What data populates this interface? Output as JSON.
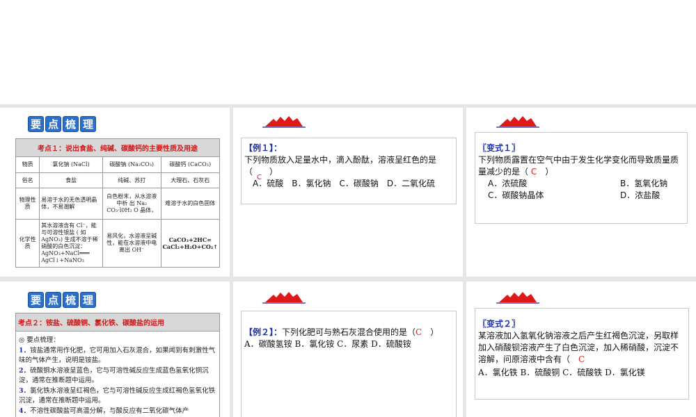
{
  "badge_chars": [
    "要",
    "点",
    "梳",
    "理"
  ],
  "slide1": {
    "header": "考点１：说出食盐、纯碱、碳酸钙的主要性质及用途",
    "rows": [
      [
        "物质",
        "氯化钠 (NaCl)",
        "碳酸钠 (Na₂CO₃)",
        "碳酸钙 (CaCO₃)"
      ],
      [
        "俗名",
        "食盐",
        "纯碱、苏打",
        "大理石、石灰石"
      ],
      [
        "物理性质",
        "易溶于水的无色透明晶体，不易潮解",
        "白色粉末，从水溶液中析 出 Na₂ CO₃·l0H₂ O 晶体，",
        "难溶于水的白色固体"
      ],
      [
        "化学性质",
        "其水溶液含有 Cl⁻，能与可溶性银盐 ( 如 AgNO₃) 生成不溶于稀硝酸的白色沉淀：AgNO₃+NaCl═══ AgCl↓+NaNO₃",
        "易风化，水溶液呈碱性，能在水溶液中电离出 OH⁻",
        "CaCO₃+2HC= CaCl₂+H₂O+CO₂↑"
      ]
    ]
  },
  "slide2": {
    "label": "【例１】：",
    "question": "下列物质放入足量水中，滴入酚酞，溶液呈红色的是（　　）",
    "answer": "C",
    "options": "A．硫酸　B．氯化钠　C．碳酸钠　D．二氧化硫"
  },
  "slide3": {
    "label": "〖变式１〗",
    "question": "下列物质露置在空气中由于发生化学变化而导致质量质量减少的是（",
    "answer": "C",
    "close": "）",
    "options": [
      "A．浓硫酸",
      "B．氢氧化钠",
      "C．碳酸钠晶体",
      "D．浓盐酸"
    ]
  },
  "slide4": {
    "header": "考点２：铵盐、硫酸铜、氯化铁、碳酸盐的运用",
    "intro": "◎ 要点梳理：",
    "points": [
      {
        "n": "1．",
        "t": "铵盐通常用作化肥，它可用加入石灰混合，如果闻到有刺激性气味的气体产生，说明是铵盐。"
      },
      {
        "n": "2．",
        "t": "硫酸铜水溶液呈蓝色，它与可溶性碱反应生成蓝色氢氧化铜沉淀，通常在推断题中运用。"
      },
      {
        "n": "3．",
        "t": "氯化铁水溶液呈红褐色，它与可溶性碱反应生成红褐色氢氧化铁沉淀，通常在推断题中运用。"
      },
      {
        "n": "4．",
        "t": "不溶性碳酸盐可高温分解，与酸反应有二氧化碳气体产"
      }
    ]
  },
  "slide5": {
    "label": "【例２】：",
    "question": "下列化肥可与熟石灰混合使用的是（",
    "answer": "C",
    "close": "）",
    "options": "A．碳酸氢铵 B．氯化铵 C．尿素 D．硫酸铵"
  },
  "slide6": {
    "label": "〖变式２〗",
    "question": "某溶液加入氢氧化钠溶液之后产生红褐色沉淀，另取样加入硝酸钡溶液产生了白色沉淀，加入稀硝酸，沉淀不溶解，问原溶液中含有（",
    "answer": "C",
    "options": "A．氯化铁 B．硫酸铜 C．硫酸铁 D．氯化镁"
  }
}
